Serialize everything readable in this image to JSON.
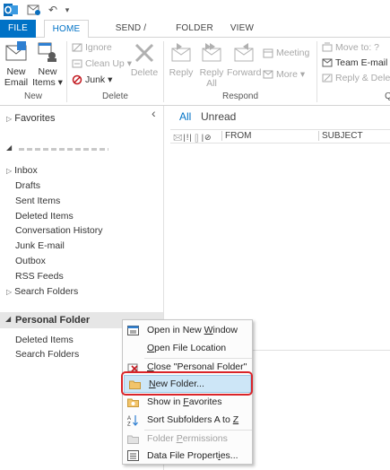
{
  "quick_access": {
    "undo_glyph": "↶",
    "dropdown_glyph": "▾"
  },
  "tabs": [
    "FILE",
    "HOME",
    "SEND / RECEIVE",
    "FOLDER",
    "VIEW"
  ],
  "ribbon": {
    "new_email": "New\nEmail",
    "new_email_l1": "New",
    "new_email_l2": "Email",
    "new_items_l1": "New",
    "new_items_l2": "Items ▾",
    "ignore": "Ignore",
    "clean_up": "Clean Up ▾",
    "junk": "Junk ▾",
    "delete": "Delete",
    "reply": "Reply",
    "reply_all_l1": "Reply",
    "reply_all_l2": "All",
    "forward": "Forward",
    "meeting": "Meeting",
    "more": "More ▾",
    "move_to": "Move to: ?",
    "team_email": "Team E-mail",
    "reply_delete": "Reply & Delet",
    "groups": {
      "new": "New",
      "delete": "Delete",
      "respond": "Respond",
      "quick": "Q"
    }
  },
  "nav": {
    "favorites": "Favorites",
    "collapse_glyph": "‹",
    "account_blurred": "",
    "folders": [
      "Inbox",
      "Drafts",
      "Sent Items",
      "Deleted Items",
      "Conversation History",
      "Junk E-mail",
      "Outbox",
      "RSS Feeds",
      "Search Folders"
    ],
    "personal_folder": "Personal Folder",
    "personal_children": [
      "Deleted Items",
      "Search Folders"
    ]
  },
  "main": {
    "filter_all": "All",
    "filter_unread": "Unread",
    "col_from": "FROM",
    "col_subject": "SUBJECT"
  },
  "context_menu": {
    "items": [
      {
        "label_pre": "Open in New ",
        "label_u": "W",
        "label_post": "indow",
        "disabled": false
      },
      {
        "label_pre": "",
        "label_u": "O",
        "label_post": "pen File Location",
        "disabled": false
      },
      {
        "label_pre": "",
        "label_u": "C",
        "label_post": "lose \"Personal Folder\"",
        "disabled": false
      },
      {
        "label_pre": "",
        "label_u": "N",
        "label_post": "ew Folder...",
        "disabled": false,
        "highlighted": true
      },
      {
        "label_pre": "Show in ",
        "label_u": "F",
        "label_post": "avorites",
        "disabled": false
      },
      {
        "label_pre": "Sort Subfolders A to ",
        "label_u": "Z",
        "label_post": "",
        "disabled": false
      },
      {
        "label_pre": "Folder ",
        "label_u": "P",
        "label_post": "ermissions",
        "disabled": true
      },
      {
        "label_pre": "Data File Propert",
        "label_u": "i",
        "label_post": "es...",
        "disabled": false
      }
    ]
  },
  "colors": {
    "accent": "#0072c6",
    "highlight_border": "#d9252a",
    "menu_highlight": "#cde6f7"
  }
}
